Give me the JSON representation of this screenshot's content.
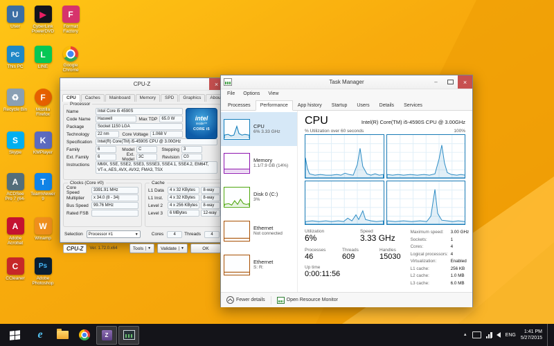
{
  "desktop": {
    "col1": [
      {
        "label": "User",
        "glyph": "U"
      },
      {
        "label": "This PC",
        "glyph": "PC"
      },
      {
        "label": "Recycle Bin",
        "glyph": "♻"
      },
      {
        "label": "Skype",
        "glyph": "S"
      },
      {
        "label": "ACDSee Pro 7 (64-bit)",
        "glyph": "A"
      },
      {
        "label": "Adobe Acrobat",
        "glyph": "A"
      },
      {
        "label": "CCleaner",
        "glyph": "C"
      }
    ],
    "col2": [
      {
        "label": "CyberLink PowerDVD 14",
        "glyph": "▶"
      },
      {
        "label": "LINE",
        "glyph": "L"
      },
      {
        "label": "Mozilla Firefox",
        "glyph": "F"
      },
      {
        "label": "KMPlayer",
        "glyph": "K"
      },
      {
        "label": "TeamViewer 9",
        "glyph": "T"
      },
      {
        "label": "Winamp",
        "glyph": "W"
      },
      {
        "label": "Adobe Photoshop",
        "glyph": "Ps"
      }
    ],
    "col3": [
      {
        "label": "Format Factory",
        "glyph": "F"
      },
      {
        "label": "Google Chrome",
        "glyph": ""
      }
    ]
  },
  "cpuz": {
    "title": "CPU-Z",
    "tabs": [
      "CPU",
      "Caches",
      "Mainboard",
      "Memory",
      "SPD",
      "Graphics",
      "About"
    ],
    "processor": {
      "group": "Processor",
      "name_label": "Name",
      "name": "Intel Core i5 4590S",
      "codename_label": "Code Name",
      "codename": "Haswell",
      "maxtdp_label": "Max TDP",
      "maxtdp": "65.0 W",
      "package_label": "Package",
      "package": "Socket 1150 LGA",
      "technology_label": "Technology",
      "technology": "22 nm",
      "corevoltage_label": "Core Voltage",
      "corevoltage": "1.068 V",
      "spec_label": "Specification",
      "spec": "Intel(R) Core(TM) i5-4590S CPU @ 3.00GHz",
      "family_label": "Family",
      "family": "6",
      "model_label": "Model",
      "model": "C",
      "stepping_label": "Stepping",
      "stepping": "3",
      "extfamily_label": "Ext. Family",
      "extfamily": "6",
      "extmodel_label": "Ext. Model",
      "extmodel": "3C",
      "revision_label": "Revision",
      "revision": "C0",
      "instructions_label": "Instructions",
      "instructions": "MMX, SSE, SSE2, SSE3, SSSE3, SSE4.1, SSE4.2, EM64T, VT-x, AES, AVX, AVX2, FMA3, TSX"
    },
    "clocks": {
      "group": "Clocks (Core #0)",
      "corespeed_label": "Core Speed",
      "corespeed": "3391.91 MHz",
      "multiplier_label": "Multiplier",
      "multiplier": "x 34.0 (8 - 34)",
      "busspeed_label": "Bus Speed",
      "busspeed": "99.76 MHz",
      "ratedfsb_label": "Rated FSB",
      "ratedfsb": ""
    },
    "cache": {
      "group": "Cache",
      "l1d_label": "L1 Data",
      "l1d": "4 x 32 KBytes",
      "l1d_way": "8-way",
      "l1i_label": "L1 Inst.",
      "l1i": "4 x 32 KBytes",
      "l1i_way": "8-way",
      "l2_label": "Level 2",
      "l2": "4 x 256 KBytes",
      "l2_way": "8-way",
      "l3_label": "Level 3",
      "l3": "6 MBytes",
      "l3_way": "12-way"
    },
    "bottom": {
      "selection_label": "Selection",
      "selection": "Processor #1",
      "cores_label": "Cores",
      "cores": "4",
      "threads_label": "Threads",
      "threads": "4"
    },
    "footer": {
      "logo": "CPU-Z",
      "version": "Ver. 1.72.0.x64",
      "tools": "Tools",
      "validate": "Validate",
      "ok": "OK"
    },
    "intel_badge": {
      "line1": "intel",
      "line2": "inside™",
      "line3": "CORE i5"
    },
    "accent_field_border": "#c3ccd3"
  },
  "taskmgr": {
    "title": "Task Manager",
    "menu": [
      "File",
      "Options",
      "View"
    ],
    "tabs": [
      "Processes",
      "Performance",
      "App history",
      "Startup",
      "Users",
      "Details",
      "Services"
    ],
    "sidebar": [
      {
        "name": "CPU",
        "detail": "6% 3.33 GHz",
        "color": "#117dbb"
      },
      {
        "name": "Memory",
        "detail": "1.1/7.9 GB (14%)",
        "color": "#8b12ae"
      },
      {
        "name": "Disk 0 (C:)",
        "detail": "3%",
        "color": "#4da60c"
      },
      {
        "name": "Ethernet",
        "detail": "Not connected",
        "color": "#a74f01"
      },
      {
        "name": "Ethernet",
        "detail": "S: R:",
        "color": "#a74f01"
      }
    ],
    "main": {
      "title": "CPU",
      "subtitle": "Intel(R) Core(TM) i5-4590S CPU @ 3.00GHz",
      "graph_label": "% Utilization over 60 seconds",
      "graph_max": "100%",
      "graph_color": "#117dbb",
      "stats_big": [
        {
          "label": "Utilization",
          "value": "6%"
        },
        {
          "label": "Speed",
          "value": "3.33 GHz"
        }
      ],
      "stats_mid": [
        {
          "label": "Processes",
          "value": "46"
        },
        {
          "label": "Threads",
          "value": "609"
        },
        {
          "label": "Handles",
          "value": "15030"
        }
      ],
      "uptime_label": "Up time",
      "uptime_value": "0:00:11:56",
      "details": [
        {
          "label": "Maximum speed:",
          "value": "3.00 GHz"
        },
        {
          "label": "Sockets:",
          "value": "1"
        },
        {
          "label": "Cores:",
          "value": "4"
        },
        {
          "label": "Logical processors:",
          "value": "4"
        },
        {
          "label": "Virtualization:",
          "value": "Enabled"
        },
        {
          "label": "L1 cache:",
          "value": "256 KB"
        },
        {
          "label": "L2 cache:",
          "value": "1.0 MB"
        },
        {
          "label": "L3 cache:",
          "value": "6.0 MB"
        }
      ]
    },
    "footer": {
      "fewer_details": "Fewer details",
      "open_resource_monitor": "Open Resource Monitor"
    }
  },
  "taskbar": {
    "lang": "ENG",
    "time": "1:41 PM",
    "date": "5/27/2015"
  }
}
